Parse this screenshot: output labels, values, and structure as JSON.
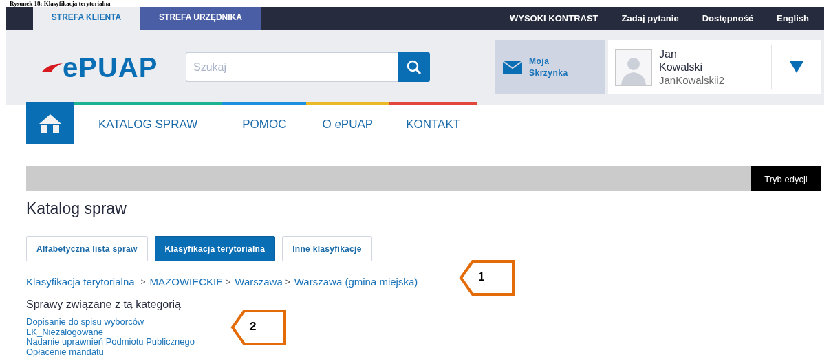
{
  "caption": "Rysunek 18: Klasyfikacja terytorialna",
  "zones": [
    {
      "label": "STREFA KLIENTA",
      "selected": true
    },
    {
      "label": "STREFA URZĘDNIKA",
      "selected": false
    }
  ],
  "top_links": [
    "WYSOKI KONTRAST",
    "Zadaj pytanie",
    "Dostępność",
    "English"
  ],
  "logo": "ePUAP",
  "search": {
    "placeholder": "Szukaj"
  },
  "mailbox": "Moja Skrzynka",
  "user": {
    "name": "Jan Kowalski",
    "login": "JanKowalskii2"
  },
  "nav": [
    {
      "label": "KATALOG SPRAW",
      "color": "#1ab394"
    },
    {
      "label": "POMOC",
      "color": "#1e90e0"
    },
    {
      "label": "O ePUAP",
      "color": "#ebb928"
    },
    {
      "label": "KONTAKT",
      "color": "#e2473c"
    }
  ],
  "edit_mode": "Tryb edycji",
  "page_title": "Katalog spraw",
  "view_tabs": [
    {
      "label": "Alfabetyczna lista spraw",
      "selected": false
    },
    {
      "label": "Klasyfikacja terytorialna",
      "selected": true
    },
    {
      "label": "Inne klasyfikacje",
      "selected": false
    }
  ],
  "breadcrumb": [
    {
      "label": "Klasyfikacja terytorialna"
    },
    {
      "separator": ">",
      "label": "MAZOWIECKIE"
    },
    {
      "separator": ">",
      "label": "Warszawa"
    },
    {
      "separator": ">",
      "label": "Warszawa (gmina miejska)"
    }
  ],
  "section_heading": "Sprawy związane z tą kategorią",
  "cases": [
    "Dopisanie do spisu wyborców",
    "LK_Niezalogowane",
    "Nadanie uprawnień Podmiotu Publicznego",
    "Opłacenie mandatu"
  ],
  "callouts": [
    {
      "number": "1"
    },
    {
      "number": "2"
    }
  ]
}
